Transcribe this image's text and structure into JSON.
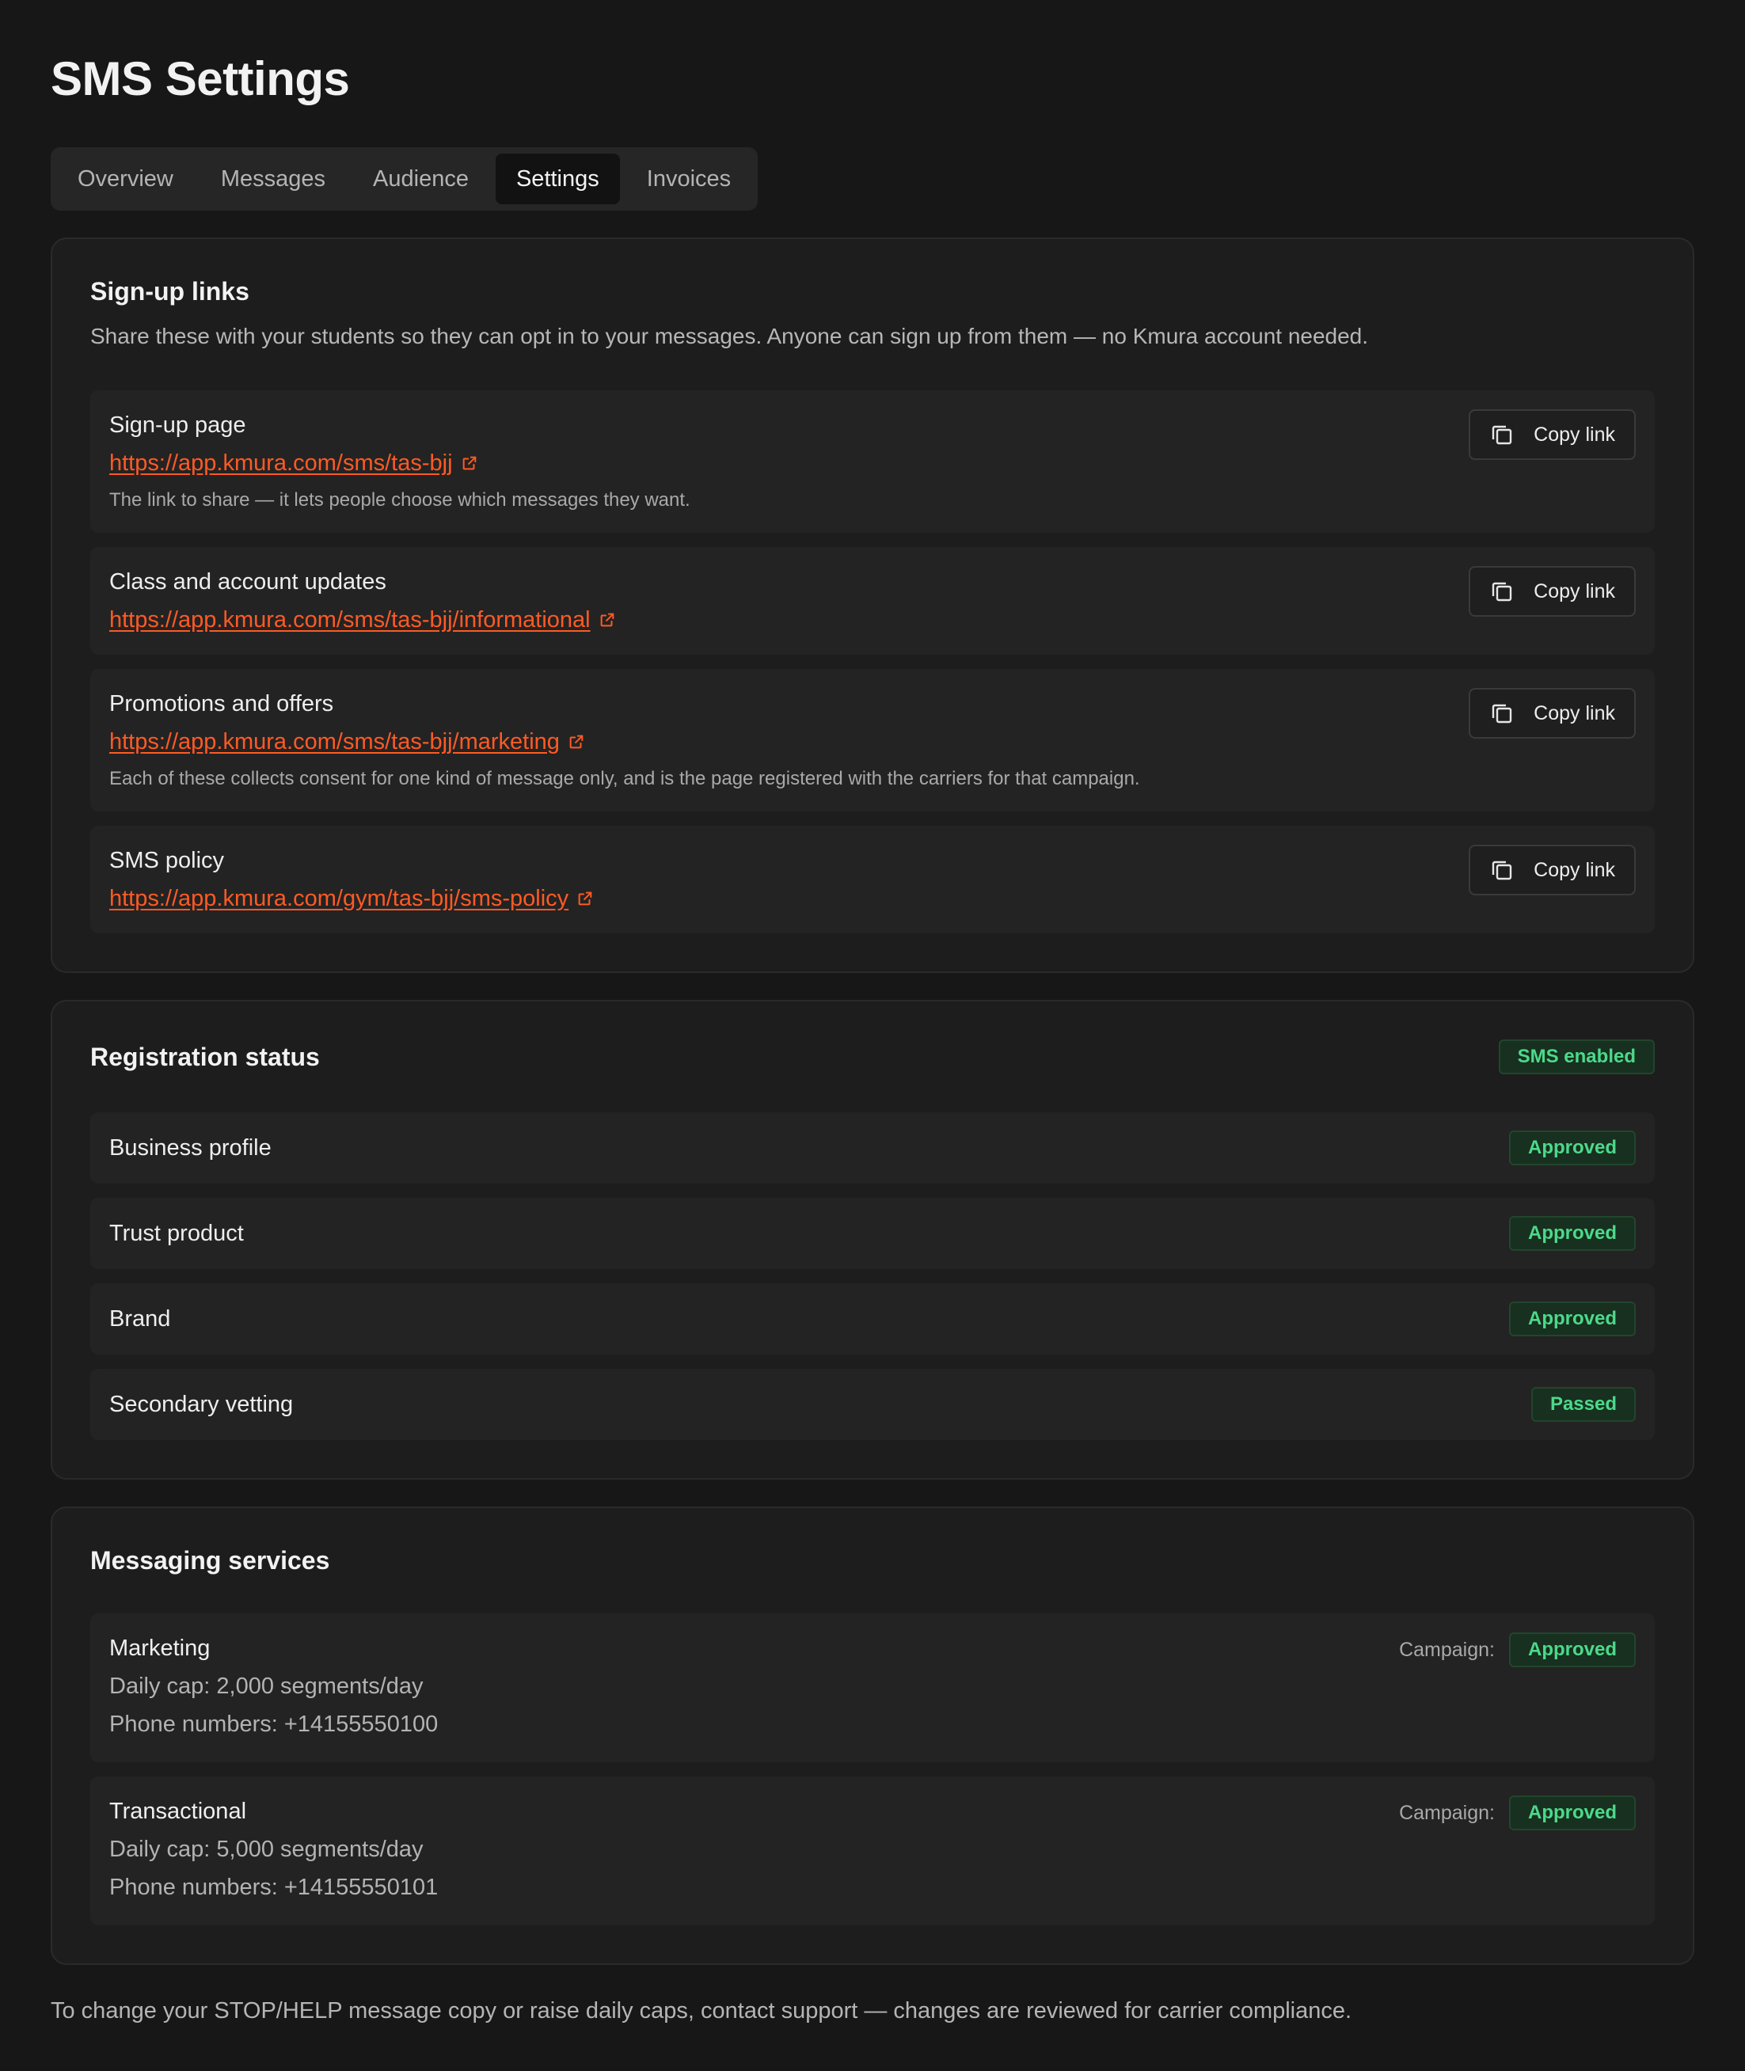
{
  "page": {
    "title": "SMS Settings"
  },
  "tabs": [
    {
      "label": "Overview",
      "active": false
    },
    {
      "label": "Messages",
      "active": false
    },
    {
      "label": "Audience",
      "active": false
    },
    {
      "label": "Settings",
      "active": true
    },
    {
      "label": "Invoices",
      "active": false
    }
  ],
  "signup": {
    "title": "Sign-up links",
    "description": "Share these with your students so they can opt in to your messages. Anyone can sign up from them — no Kmura account needed.",
    "copy_label": "Copy link",
    "items": [
      {
        "label": "Sign-up page",
        "url": "https://app.kmura.com/sms/tas-bjj",
        "note": "The link to share — it lets people choose which messages they want."
      },
      {
        "label": "Class and account updates",
        "url": "https://app.kmura.com/sms/tas-bjj/informational",
        "note": ""
      },
      {
        "label": "Promotions and offers",
        "url": "https://app.kmura.com/sms/tas-bjj/marketing",
        "note": "Each of these collects consent for one kind of message only, and is the page registered with the carriers for that campaign."
      },
      {
        "label": "SMS policy",
        "url": "https://app.kmura.com/gym/tas-bjj/sms-policy",
        "note": ""
      }
    ]
  },
  "registration": {
    "title": "Registration status",
    "overall_badge": "SMS enabled",
    "items": [
      {
        "label": "Business profile",
        "status": "Approved"
      },
      {
        "label": "Trust product",
        "status": "Approved"
      },
      {
        "label": "Brand",
        "status": "Approved"
      },
      {
        "label": "Secondary vetting",
        "status": "Passed"
      }
    ]
  },
  "messaging": {
    "title": "Messaging services",
    "campaign_label": "Campaign:",
    "services": [
      {
        "name": "Marketing",
        "daily_cap": "Daily cap: 2,000 segments/day",
        "phones": "Phone numbers: +14155550100",
        "campaign_status": "Approved"
      },
      {
        "name": "Transactional",
        "daily_cap": "Daily cap: 5,000 segments/day",
        "phones": "Phone numbers: +14155550101",
        "campaign_status": "Approved"
      }
    ]
  },
  "footer": {
    "note": "To change your STOP/HELP message copy or raise daily caps, contact support — changes are reviewed for carrier compliance."
  },
  "colors": {
    "accent_link": "#ff5a24",
    "success": "#4cd98a",
    "background": "#171717",
    "card": "#1d1d1d"
  }
}
